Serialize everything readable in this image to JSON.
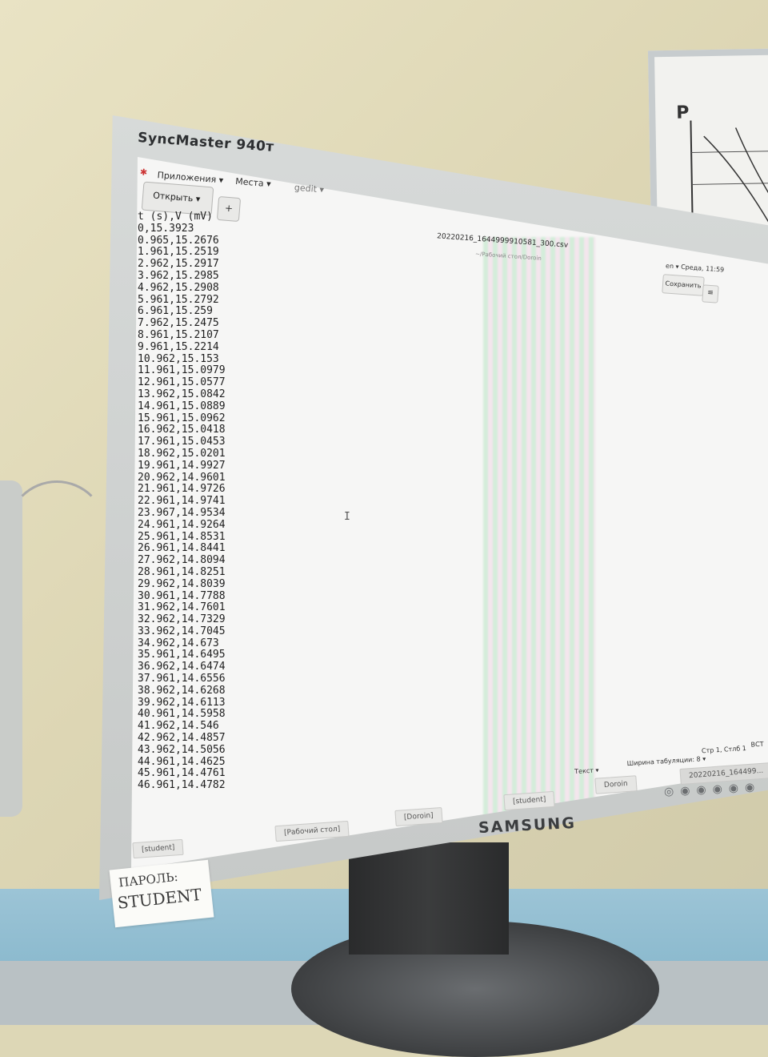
{
  "monitor": {
    "model": "SyncMaster 940т",
    "brand": "SAMSUNG"
  },
  "topbar": {
    "apps_menu": "Приложения ▾",
    "places_menu": "Места ▾",
    "gedit_menu": "gedit ▾"
  },
  "toolbar": {
    "open_label": "Открыть ▾",
    "new_tab_label": "+"
  },
  "window": {
    "file_title": "20220216_1644999910581_300.csv",
    "file_path": "~/Рабочий стол/Doroin",
    "tray": "en ▾   Среда, 11:59",
    "save_label": "Сохранить",
    "menu_label": "≡"
  },
  "editor": {
    "lines": [
      "t (s),V (mV)",
      "0,15.3923",
      "0.965,15.2676",
      "1.961,15.2519",
      "2.962,15.2917",
      "3.962,15.2985",
      "4.962,15.2908",
      "5.961,15.2792",
      "6.961,15.259",
      "7.962,15.2475",
      "8.961,15.2107",
      "9.961,15.2214",
      "10.962,15.153",
      "11.961,15.0979",
      "12.961,15.0577",
      "13.962,15.0842",
      "14.961,15.0889",
      "15.961,15.0962",
      "16.962,15.0418",
      "17.961,15.0453",
      "18.962,15.0201",
      "19.961,14.9927",
      "20.962,14.9601",
      "21.961,14.9726",
      "22.961,14.9741",
      "23.967,14.9534",
      "24.961,14.9264",
      "25.961,14.8531",
      "26.961,14.8441",
      "27.962,14.8094",
      "28.961,14.8251",
      "29.962,14.8039",
      "30.961,14.7788",
      "31.962,14.7601",
      "32.962,14.7329",
      "33.962,14.7045",
      "34.962,14.673",
      "35.961,14.6495",
      "36.962,14.6474",
      "37.961,14.6556",
      "38.962,14.6268",
      "39.962,14.6113",
      "40.961,14.5958",
      "41.962,14.546",
      "42.962,14.4857",
      "43.962,14.5056",
      "44.961,14.4625",
      "45.961,14.4761",
      "46.961,14.4782"
    ]
  },
  "statusbar": {
    "mode": "Текст ▾",
    "tab_width": "Ширина табуляции: 8 ▾",
    "position": "Стр 1, Стлб 1",
    "insert": "ВСТ"
  },
  "taskbar": {
    "items": [
      "[student]",
      "[Рабочий стол]",
      "[Doroin]",
      "[student]",
      "Doroin",
      "20220216_164499..."
    ]
  },
  "sticky_note": {
    "line1": "ПАРОЛЬ:",
    "line2": "STUDENT"
  },
  "whiteboard": {
    "letter": "P"
  }
}
